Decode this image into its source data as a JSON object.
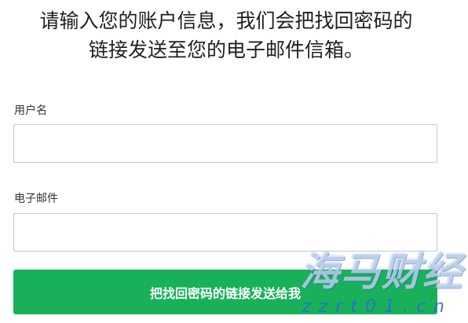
{
  "intro": {
    "line1": "请输入您的账户信息，我们会把找回密码的",
    "line2": "链接发送至您的电子邮件信箱。"
  },
  "form": {
    "username_label": "用户名",
    "username_value": "",
    "email_label": "电子邮件",
    "email_value": "",
    "submit_label": "把找回密码的链接发送给我"
  },
  "watermark": {
    "main": "海马财经",
    "sub": "zzrt01.cn"
  },
  "colors": {
    "button": "#18b15a",
    "button_text": "#ffffff",
    "input_border": "#c8c8c8",
    "watermark_sub": "#286ed2"
  }
}
